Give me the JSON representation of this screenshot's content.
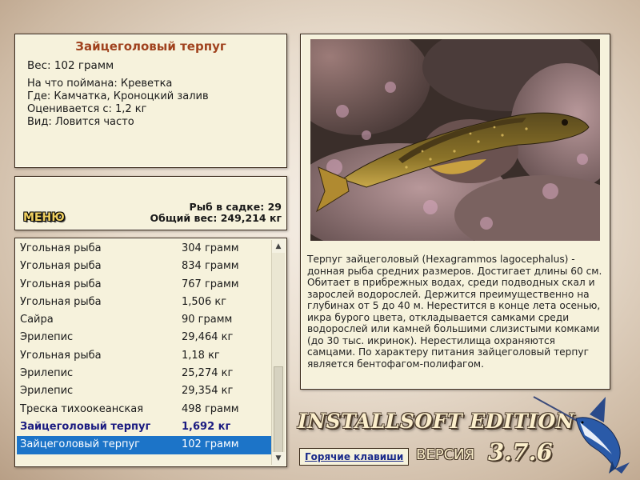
{
  "catch": {
    "title": "Зайцеголовый терпуг",
    "weight": "Вес: 102 грамм",
    "bait": "На что поймана: Креветка",
    "location": "Где: Камчатка, Кроноцкий залив",
    "valued_from": "Оценивается с: 1,2 кг",
    "frequency": "Вид: Ловится часто"
  },
  "stats": {
    "menu_label": "МЕНЮ",
    "fish_count": "Рыб в садке: 29",
    "total_weight": "Общий вес: 249,214 кг"
  },
  "list": {
    "rows": [
      {
        "name": "Угольная рыба",
        "weight": "304 грамм"
      },
      {
        "name": "Угольная рыба",
        "weight": "834 грамм"
      },
      {
        "name": "Угольная рыба",
        "weight": "767 грамм"
      },
      {
        "name": "Угольная рыба",
        "weight": "1,506 кг"
      },
      {
        "name": "Сайра",
        "weight": "90 грамм"
      },
      {
        "name": "Эрилепис",
        "weight": "29,464 кг"
      },
      {
        "name": "Угольная рыба",
        "weight": "1,18 кг"
      },
      {
        "name": "Эрилепис",
        "weight": "25,274 кг"
      },
      {
        "name": "Эрилепис",
        "weight": "29,354 кг"
      },
      {
        "name": "Треска тихоокеанская",
        "weight": "498 грамм"
      },
      {
        "name": "Зайцеголовый терпуг",
        "weight": "1,692 кг"
      },
      {
        "name": "Зайцеголовый терпуг",
        "weight": "102 грамм"
      }
    ],
    "scroll_up_icon": "triangle-up",
    "scroll_down_icon": "triangle-down"
  },
  "description": "Терпуг зайцеголовый (Hexagrammos lagocephalus) - донная рыба средних размеров. Достигает длины 60 см. Обитает в прибрежных водах, среди подводных скал и зарослей водорослей. Держится преимущественно на глубинах от 5 до 40 м. Нерестится в конце лета осенью, икра бурого цвета, откладывается самками среди водорослей или камней большими слизистыми комками (до 30 тыс. икринок). Нерестилища охраняются самцами. По характеру питания зайцеголовый терпуг является бентофагом-полифагом.",
  "footer": {
    "brand": "INSTALLSOFT EDITION",
    "hotkeys": "Горячие клавиши",
    "version_label": "ВЕРСИЯ",
    "version_number": "3.7.6"
  },
  "colors": {
    "panel_bg": "#f6f2dc",
    "title": "#a0421e",
    "selected_row": "#1c74c8",
    "highlight_row_text": "#1a1a80"
  }
}
